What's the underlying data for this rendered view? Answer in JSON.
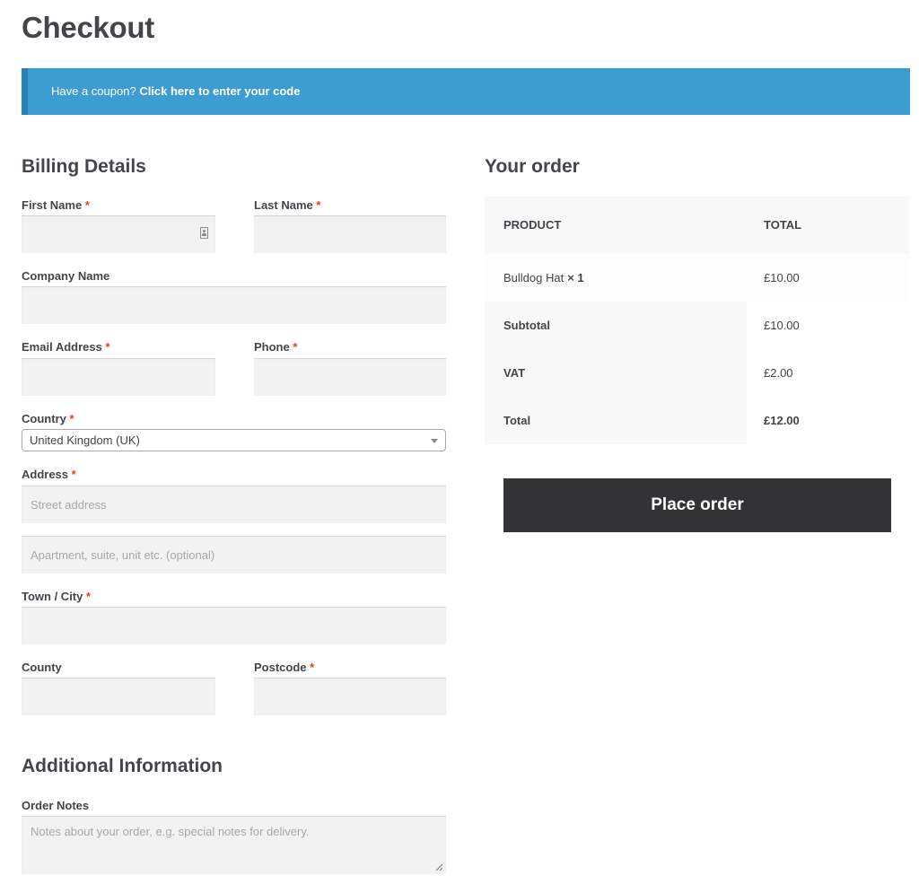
{
  "page": {
    "title": "Checkout"
  },
  "coupon_notice": {
    "text": "Have a coupon?",
    "link": "Click here to enter your code"
  },
  "billing": {
    "title": "Billing Details",
    "required_marker": "*",
    "first_name": {
      "label": "First Name",
      "value": ""
    },
    "last_name": {
      "label": "Last Name",
      "value": ""
    },
    "company": {
      "label": "Company Name",
      "value": ""
    },
    "email": {
      "label": "Email Address",
      "value": ""
    },
    "phone": {
      "label": "Phone",
      "value": ""
    },
    "country": {
      "label": "Country",
      "value": "United Kingdom (UK)"
    },
    "address": {
      "label": "Address",
      "placeholder_1": "Street address",
      "placeholder_2": "Apartment, suite, unit etc. (optional)"
    },
    "city": {
      "label": "Town / City",
      "value": ""
    },
    "county": {
      "label": "County",
      "value": ""
    },
    "postcode": {
      "label": "Postcode",
      "value": ""
    }
  },
  "additional": {
    "title": "Additional Information",
    "notes": {
      "label": "Order Notes",
      "placeholder": "Notes about your order, e.g. special notes for delivery."
    }
  },
  "order": {
    "title": "Your order",
    "headers": {
      "product": "Product",
      "total": "Total"
    },
    "items": [
      {
        "name": "Bulldog Hat",
        "qty": "× 1",
        "total": "£10.00"
      }
    ],
    "subtotal": {
      "label": "Subtotal",
      "value": "£10.00"
    },
    "vat": {
      "label": "VAT",
      "value": "£2.00"
    },
    "total": {
      "label": "Total",
      "value": "£12.00"
    },
    "place_order_label": "Place order"
  },
  "colors": {
    "notice_bg": "#3d9cd2",
    "required": "#e2401c",
    "button_bg": "#333336"
  }
}
